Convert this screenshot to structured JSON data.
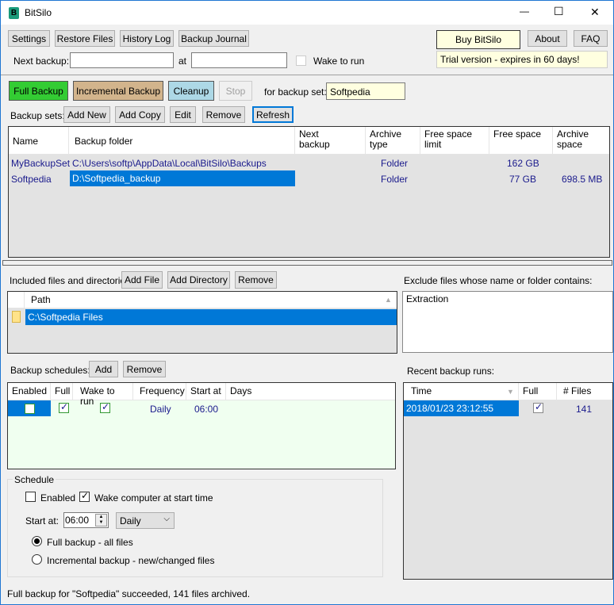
{
  "window": {
    "title": "BitSilo",
    "minimize": "—",
    "maximize": "☐",
    "close": "✕"
  },
  "toolbar": {
    "settings": "Settings",
    "restore": "Restore Files",
    "history": "History Log",
    "journal": "Backup Journal",
    "buy": "Buy BitSilo",
    "about": "About",
    "faq": "FAQ",
    "trial": "Trial version - expires in 60 days!"
  },
  "next": {
    "label": "Next backup:",
    "value": "",
    "at": "at",
    "at_value": "",
    "wake": "Wake to run",
    "wake_checked": false
  },
  "actions": {
    "full": "Full Backup",
    "incremental": "Incremental Backup",
    "cleanup": "Cleanup",
    "stop": "Stop",
    "for_set": "for backup set:",
    "set_value": "Softpedia"
  },
  "sets": {
    "label": "Backup sets:",
    "add_new": "Add New",
    "add_copy": "Add Copy",
    "edit": "Edit",
    "remove": "Remove",
    "refresh": "Refresh",
    "columns": [
      "Name",
      "Backup folder",
      "Next backup",
      "Archive type",
      "Free space limit",
      "Free space",
      "Archive space"
    ],
    "rows": [
      {
        "name": "MyBackupSet",
        "folder": "C:\\Users\\softp\\AppData\\Local\\BitSilo\\Backups",
        "next": "",
        "type": "Folder",
        "limit": "",
        "free": "162 GB",
        "archive": ""
      },
      {
        "name": "Softpedia",
        "folder": "D:\\Softpedia_backup",
        "next": "",
        "type": "Folder",
        "limit": "",
        "free": "77 GB",
        "archive": "698.5 MB"
      }
    ]
  },
  "included": {
    "label": "Included files and directories:",
    "add_file": "Add File",
    "add_dir": "Add Directory",
    "remove": "Remove",
    "path_header": "Path",
    "rows": [
      "C:\\Softpedia Files"
    ]
  },
  "exclude": {
    "label": "Exclude files whose name or folder contains:",
    "value": "Extraction"
  },
  "schedules": {
    "label": "Backup schedules:",
    "add": "Add",
    "remove": "Remove",
    "columns": [
      "Enabled",
      "Full",
      "Wake to run",
      "Frequency",
      "Start at",
      "Days"
    ],
    "rows": [
      {
        "enabled": false,
        "full": true,
        "wake": true,
        "frequency": "Daily",
        "start": "06:00",
        "days": ""
      }
    ]
  },
  "recent": {
    "label": "Recent backup runs:",
    "columns": [
      "Time",
      "Full",
      "# Files"
    ],
    "rows": [
      {
        "time": "2018/01/23 23:12:55",
        "full": true,
        "files": "141"
      }
    ]
  },
  "schedule": {
    "legend": "Schedule",
    "enabled": "Enabled",
    "enabled_checked": false,
    "wake": "Wake computer at start time",
    "wake_checked": true,
    "start_label": "Start at:",
    "start_value": "06:00",
    "frequency": "Daily",
    "full_radio": "Full backup - all files",
    "inc_radio": "Incremental backup - new/changed files",
    "selected": "full"
  },
  "status": "Full backup for \"Softpedia\" succeeded, 141 files archived."
}
